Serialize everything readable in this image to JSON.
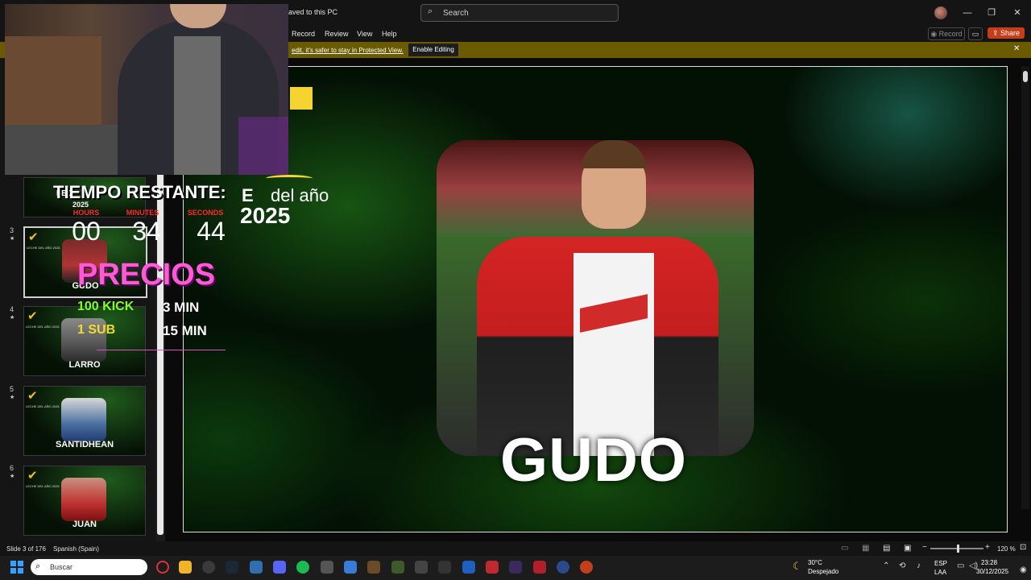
{
  "window": {
    "title": "aved to this PC",
    "search_placeholder": "Search",
    "minimize": "—",
    "maximize": "❐",
    "close": "✕"
  },
  "menu": {
    "items": [
      "Record",
      "Review",
      "View",
      "Help"
    ],
    "record_button": "Record",
    "share_button": "Share"
  },
  "protected_bar": {
    "message": "edit, it's safer to stay in Protected View.",
    "enable_button": "Enable Editing",
    "close": "✕"
  },
  "slides": {
    "thumbnails": [
      {
        "num": "3",
        "name": "GUDO"
      },
      {
        "num": "4",
        "name": "LARRO"
      },
      {
        "num": "5",
        "name": "SANTIDHEAN"
      },
      {
        "num": "6",
        "name": "JUAN"
      }
    ],
    "partial_thumb_text": "LEC",
    "partial_thumb_year": "2025"
  },
  "overlay": {
    "countdown_label": "TIEMPO RESTANTE:",
    "units": [
      "HOURS",
      "MINUTES",
      "SECONDS"
    ],
    "values": [
      "00",
      "34",
      "44"
    ],
    "precios": "PRECIOS",
    "price1_a": "100 KICK",
    "price1_b": "3 MIN",
    "price2_a": "1 SUB",
    "price2_b": "15 MIN"
  },
  "slide": {
    "title_a": "E",
    "title_b": "del año",
    "year": "2025",
    "main_name": "GUDO"
  },
  "status": {
    "slide_count": "Slide 3 of 176",
    "language": "Spanish (Spain)",
    "zoom": "120 %"
  },
  "taskbar": {
    "search_placeholder": "Buscar",
    "weather_temp": "30°C",
    "weather_cond": "Despejado",
    "lang_a": "ESP",
    "lang_b": "LAA",
    "time": "23:28",
    "date": "30/12/2025"
  },
  "colors": {
    "accent_share": "#c43e1c",
    "precios": "#ff5ad6",
    "kick_green": "#7cff2a",
    "sub_yellow": "#f5dc2a",
    "countdown_red": "#ff2a2a"
  }
}
